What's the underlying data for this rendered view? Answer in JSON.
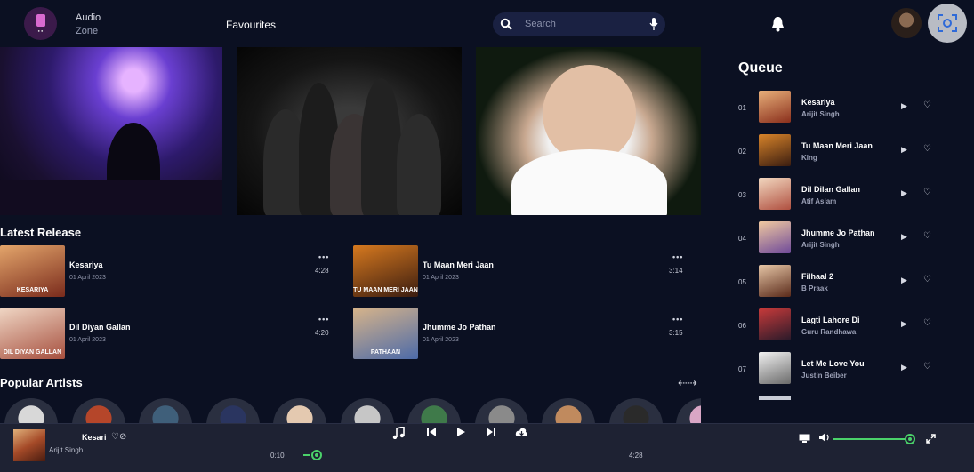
{
  "header": {
    "brand_line1": "Audio",
    "brand_line2": "Zone",
    "favourites_label": "Favourites",
    "search_placeholder": "Search",
    "icons": [
      "logo-icon",
      "search-icon",
      "mic-icon",
      "bell-icon",
      "user-avatar",
      "screen-capture-icon"
    ]
  },
  "banners": [
    "dj-concert",
    "rock-band",
    "pop-artist"
  ],
  "latest_release": {
    "title": "Latest Release",
    "more_label": "•••",
    "items": [
      {
        "title": "Kesariya",
        "date": "01 April 2023",
        "duration": "4:28",
        "thumb_text": "KESARIYA",
        "color_a": "#e3a56b",
        "color_b": "#7a2b1c"
      },
      {
        "title": "Tu Maan Meri Jaan",
        "date": "01 April 2023",
        "duration": "3:14",
        "thumb_text": "TU MAAN MERI JAAN",
        "color_a": "#d6791f",
        "color_b": "#3a1c10"
      },
      {
        "title": "Dil Diyan Gallan",
        "date": "01 April 2023",
        "duration": "4:20",
        "thumb_text": "DIL DIYAN GALLAN",
        "color_a": "#f0d7c5",
        "color_b": "#a64f3e"
      },
      {
        "title": "Jhumme Jo Pathan",
        "date": "01 April 2023",
        "duration": "3:15",
        "thumb_text": "PATHAAN",
        "color_a": "#d7b48a",
        "color_b": "#4c6aa8"
      }
    ]
  },
  "popular_artists": {
    "title": "Popular Artists",
    "arrows_label": "⇠⇢",
    "colors": [
      "#d8d8d8",
      "#b5462a",
      "#3f5f7a",
      "#2a3560",
      "#e4c9b0",
      "#c6c6c6",
      "#3f7a4a",
      "#8a8a8a",
      "#c08a5e",
      "#2a2a2a",
      "#d9a6c5"
    ]
  },
  "queue": {
    "title": "Queue",
    "items": [
      {
        "num": "01",
        "name": "Kesariya",
        "artist": "Arijit Singh",
        "color_a": "#e8b07a",
        "color_b": "#8a2f1c"
      },
      {
        "num": "02",
        "name": "Tu Maan Meri Jaan",
        "artist": "King",
        "color_a": "#d8842a",
        "color_b": "#3b1d10"
      },
      {
        "num": "03",
        "name": "Dil Dilan Gallan",
        "artist": "Atif Aslam",
        "color_a": "#f2d8c0",
        "color_b": "#b05040"
      },
      {
        "num": "04",
        "name": "Jhumme Jo Pathan",
        "artist": "Arijit Singh",
        "color_a": "#f0c9a0",
        "color_b": "#6f4a9a"
      },
      {
        "num": "05",
        "name": "Filhaal 2",
        "artist": "B Praak",
        "color_a": "#e6c6a6",
        "color_b": "#5a2a1a"
      },
      {
        "num": "06",
        "name": "Lagti Lahore Di",
        "artist": "Guru Randhawa",
        "color_a": "#c73a3a",
        "color_b": "#2a1a2a"
      },
      {
        "num": "07",
        "name": "Let Me Love You",
        "artist": "Justin Beiber",
        "color_a": "#f2f2f2",
        "color_b": "#6a6a6a"
      }
    ]
  },
  "player": {
    "title": "Kesari",
    "artist": "Arijit Singh",
    "icons_label": "♡⊘",
    "current_time": "0:10",
    "total_time": "4:28",
    "progress": 0.04,
    "volume": 0.97,
    "controls": [
      "music-note-icon",
      "previous-icon",
      "play-icon",
      "next-icon",
      "cloud-download-icon"
    ],
    "right_icons": [
      "screen-icon",
      "volume-icon",
      "fullscreen-icon"
    ]
  },
  "colors": {
    "background": "#0b1022",
    "player_bg": "#1e2233",
    "accent": "#4bd26a",
    "search_bg": "#1a2142"
  }
}
